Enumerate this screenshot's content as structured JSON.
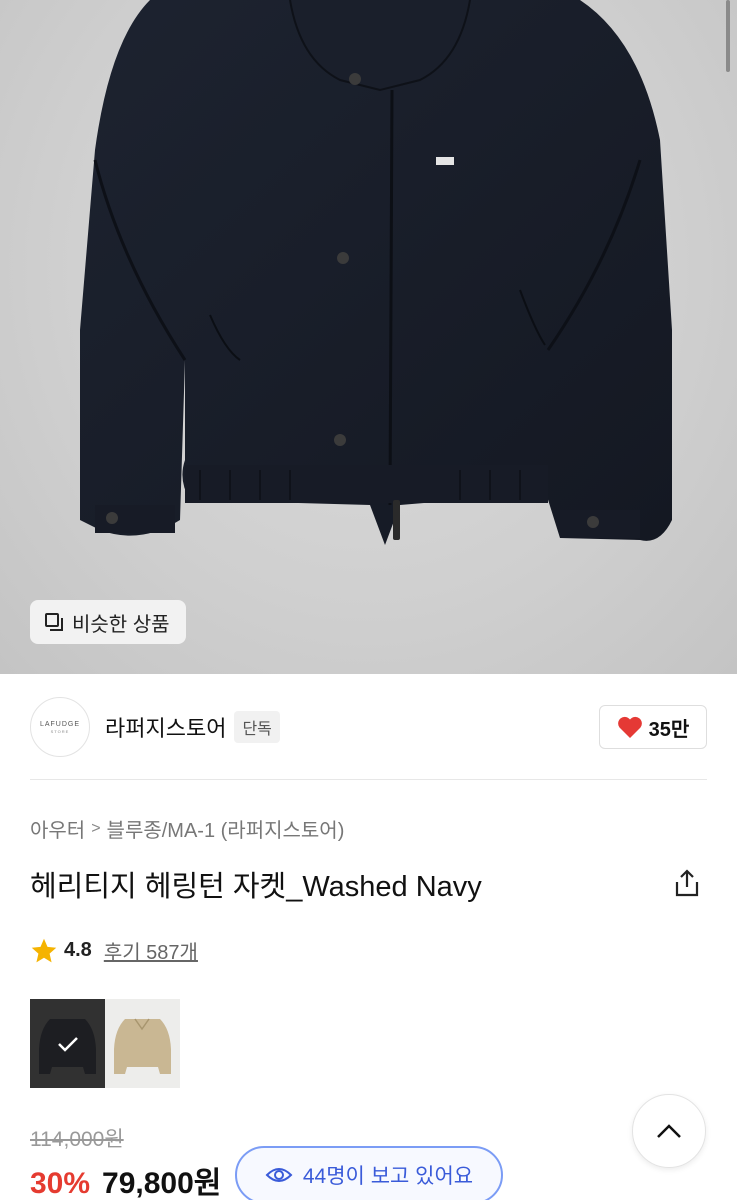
{
  "hero": {
    "similar_button_label": "비슷한 상품"
  },
  "shop": {
    "logo_text": "LAFUDGE",
    "logo_subtext": "STORE",
    "name": "라퍼지스토어",
    "badge": "단독",
    "like_count": "35만"
  },
  "breadcrumb": {
    "category": "아우터",
    "separator": ">",
    "subcategory": "블루종/MA-1 (라퍼지스토어)"
  },
  "product": {
    "title": "헤리티지 헤링턴 자켓_Washed Navy",
    "rating": "4.8",
    "review_label": "후기 587개",
    "original_price": "114,000원",
    "discount": "30%",
    "sale_price": "79,800원"
  },
  "viewers": {
    "text": "44명이 보고 있어요"
  },
  "colors": {
    "discount_red": "#e53b30",
    "heart_red": "#e53935",
    "star_yellow": "#f5b301",
    "pill_blue": "#3a5bd9"
  }
}
